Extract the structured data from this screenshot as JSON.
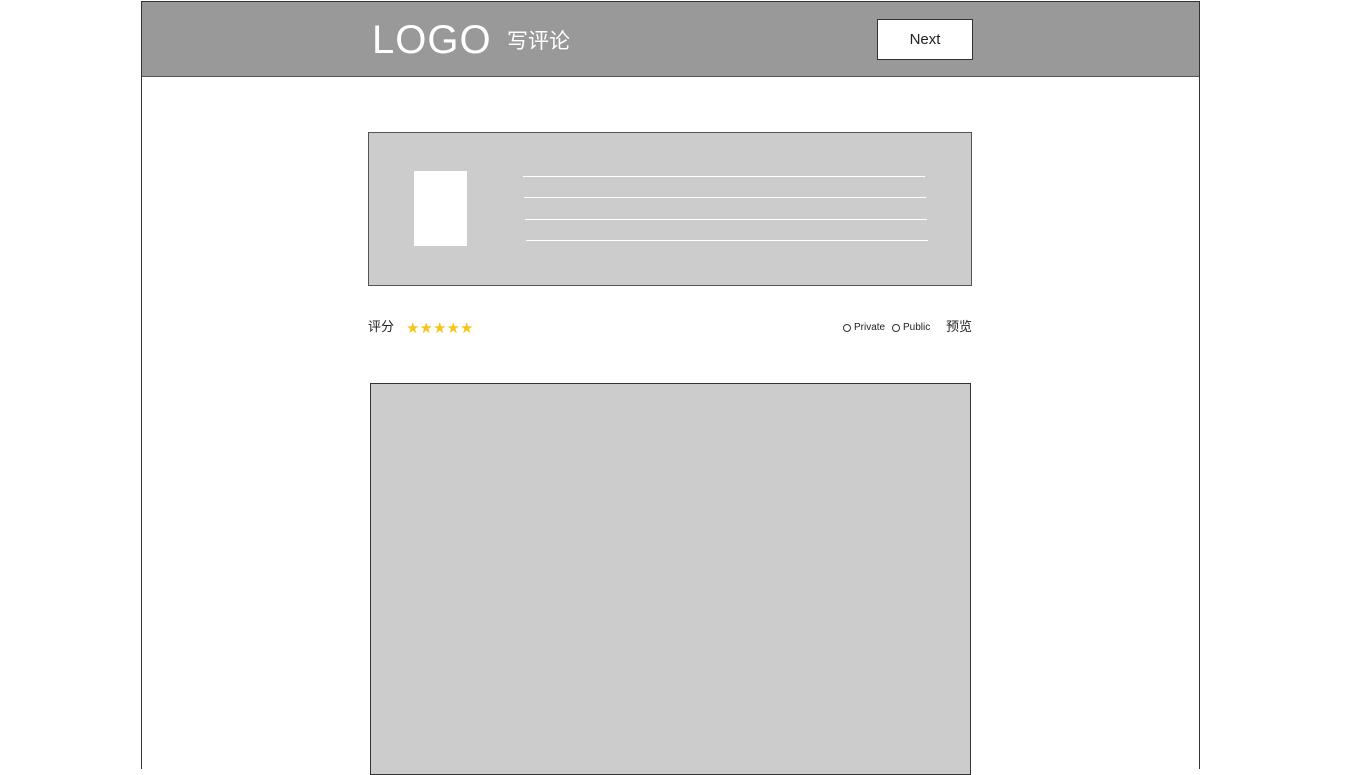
{
  "header": {
    "logo": "LOGO",
    "title": "写评论",
    "next_label": "Next"
  },
  "rating": {
    "label": "评分",
    "stars": [
      "★",
      "★",
      "★",
      "★",
      "★"
    ],
    "value": 5,
    "max": 5
  },
  "visibility": {
    "options": [
      {
        "label": "Private"
      },
      {
        "label": "Public"
      }
    ]
  },
  "preview_label": "预览",
  "colors": {
    "header_bg": "#999999",
    "panel_bg": "#cccccc",
    "star": "#f5c518"
  }
}
